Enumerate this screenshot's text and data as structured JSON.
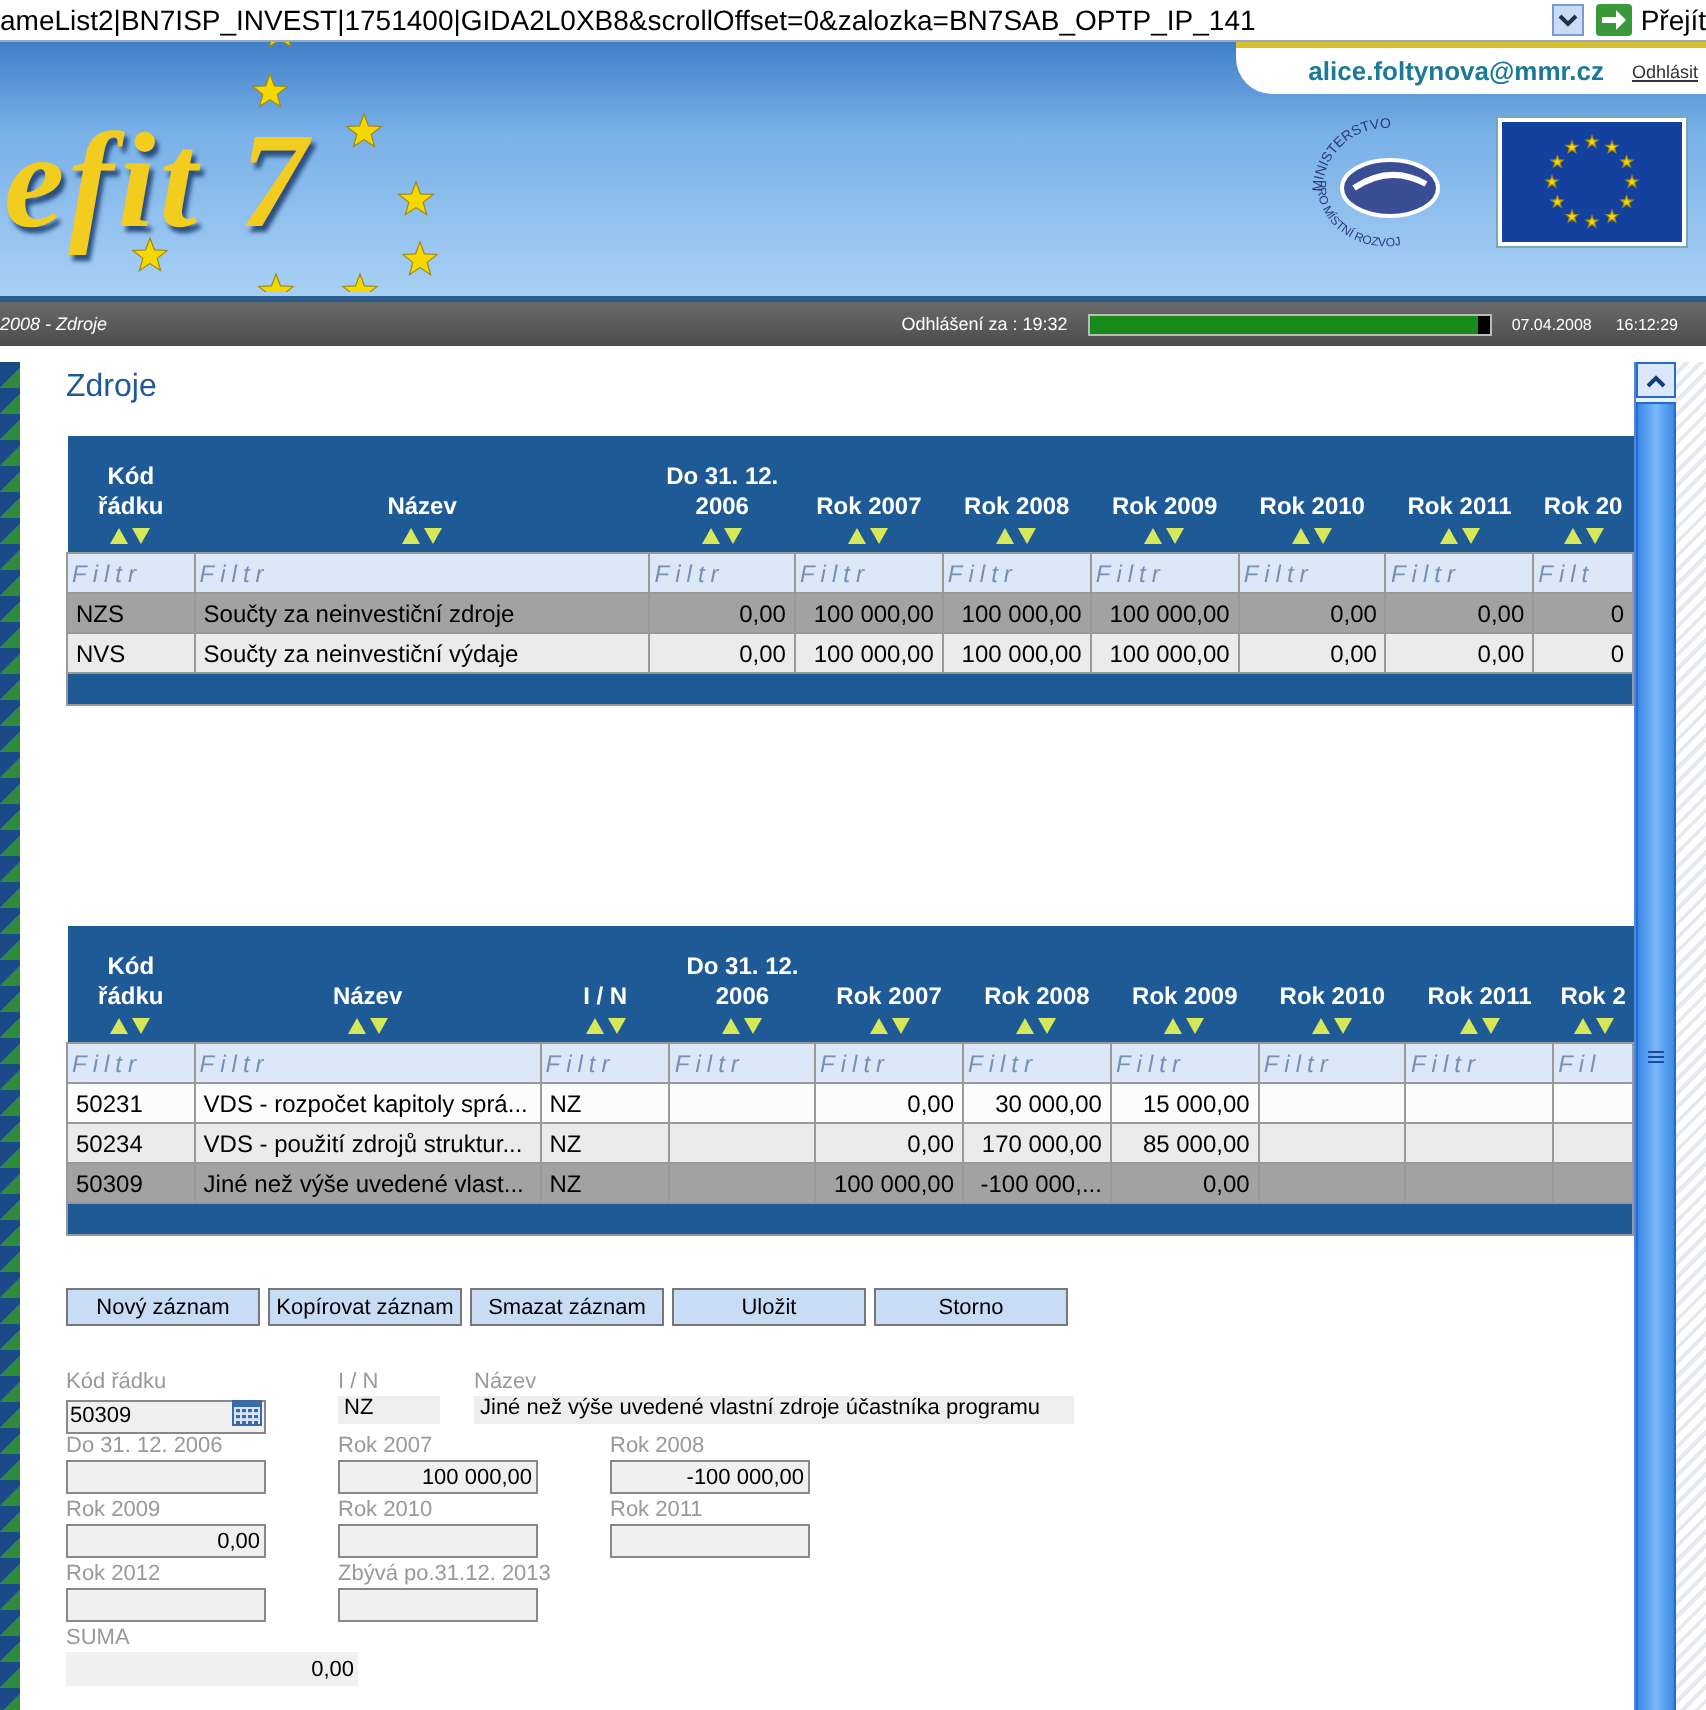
{
  "address_bar": {
    "url": "ameList2|BN7ISP_INVEST|1751400|GIDA2L0XB8&scrollOffset=0&zalozka=BN7SAB_OPTP_IP_141",
    "go_button": "Přejít"
  },
  "banner": {
    "logo_text": "efit 7",
    "ministry_top": "MINISTERSTVO",
    "ministry_bottom": "PRO MÍSTNÍ ROZVOJ",
    "user": "alice.foltynova@mmr.cz",
    "logout": "Odhlásit"
  },
  "status_bar": {
    "breadcrumb": "2008 - Zdroje",
    "logout_timer": "Odhlášení za : 19:32",
    "level": 0.97,
    "date": "07.04.2008",
    "time": "16:12:29"
  },
  "page_title": "Zdroje",
  "tables": [
    {
      "columns": [
        {
          "label": "Kód řádku",
          "kind": "text",
          "placeholder": "Filtr"
        },
        {
          "label": "Název",
          "kind": "text",
          "placeholder": "Filtr"
        },
        {
          "label": "Do 31. 12. 2006",
          "kind": "number",
          "placeholder": "Filtr"
        },
        {
          "label": "Rok 2007",
          "kind": "number",
          "placeholder": "Filtr"
        },
        {
          "label": "Rok 2008",
          "kind": "number",
          "placeholder": "Filtr"
        },
        {
          "label": "Rok 2009",
          "kind": "number",
          "placeholder": "Filtr"
        },
        {
          "label": "Rok 2010",
          "kind": "number",
          "placeholder": "Filtr"
        },
        {
          "label": "Rok 2011",
          "kind": "number",
          "placeholder": "Filtr"
        },
        {
          "label": "Rok 20",
          "kind": "number",
          "placeholder": "Filt"
        }
      ],
      "rows": [
        {
          "selected": true,
          "cells": [
            "NZS",
            "Součty za neinvestiční zdroje",
            "0,00",
            "100 000,00",
            "100 000,00",
            "100 000,00",
            "0,00",
            "0,00",
            "0"
          ]
        },
        {
          "selected": false,
          "cells": [
            "NVS",
            "Součty za neinvestiční výdaje",
            "0,00",
            "100 000,00",
            "100 000,00",
            "100 000,00",
            "0,00",
            "0,00",
            "0"
          ]
        }
      ]
    },
    {
      "columns": [
        {
          "label": "Kód řádku",
          "kind": "text",
          "placeholder": "Filtr"
        },
        {
          "label": "Název",
          "kind": "text",
          "placeholder": "Filtr"
        },
        {
          "label": "I / N",
          "kind": "text",
          "placeholder": "Filtr"
        },
        {
          "label": "Do 31. 12. 2006",
          "kind": "number",
          "placeholder": "Filtr"
        },
        {
          "label": "Rok 2007",
          "kind": "number",
          "placeholder": "Filtr"
        },
        {
          "label": "Rok 2008",
          "kind": "number",
          "placeholder": "Filtr"
        },
        {
          "label": "Rok 2009",
          "kind": "number",
          "placeholder": "Filtr"
        },
        {
          "label": "Rok 2010",
          "kind": "number",
          "placeholder": "Filtr"
        },
        {
          "label": "Rok 2011",
          "kind": "number",
          "placeholder": "Filtr"
        },
        {
          "label": "Rok 2",
          "kind": "number",
          "placeholder": "Fil"
        }
      ],
      "rows": [
        {
          "selected": false,
          "cells": [
            "50231",
            "VDS - rozpočet kapitoly sprá...",
            "NZ",
            "",
            "0,00",
            "30 000,00",
            "15 000,00",
            "",
            "",
            ""
          ]
        },
        {
          "selected": false,
          "cells": [
            "50234",
            "VDS - použití zdrojů struktur...",
            "NZ",
            "",
            "0,00",
            "170 000,00",
            "85 000,00",
            "",
            "",
            ""
          ]
        },
        {
          "selected": true,
          "cells": [
            "50309",
            "Jiné než výše uvedené vlast...",
            "NZ",
            "",
            "100 000,00",
            "-100 000,...",
            "0,00",
            "",
            "",
            ""
          ]
        }
      ]
    }
  ],
  "buttons": [
    "Nový záznam",
    "Kopírovat záznam",
    "Smazat záznam",
    "Uložit",
    "Storno"
  ],
  "form": [
    [
      {
        "label": "Kód řádku",
        "value": "50309",
        "kind": "picker"
      },
      {
        "label": "I / N",
        "value": "NZ",
        "kind": "short"
      },
      {
        "label": "Název",
        "value": "Jiné než výše uvedené vlastní zdroje účastníka programu",
        "kind": "wide"
      }
    ],
    [
      {
        "label": "Do 31. 12. 2006",
        "kind": "field"
      },
      {
        "label": "Rok 2007",
        "value": "100 000,00",
        "kind": "field"
      },
      {
        "label": "Rok 2008",
        "value": "-100 000,00",
        "kind": "field"
      }
    ],
    [
      {
        "label": "Rok 2009",
        "value": "0,00",
        "kind": "field"
      },
      {
        "label": "Rok 2010",
        "kind": "field"
      },
      {
        "label": "Rok 2011",
        "kind": "field"
      }
    ],
    [
      {
        "label": "Rok 2012",
        "kind": "field"
      },
      {
        "label": "Zbývá po.31.12. 2013",
        "kind": "field"
      }
    ],
    [
      {
        "label": "SUMA",
        "value": "0,00",
        "kind": "sum"
      }
    ]
  ]
}
